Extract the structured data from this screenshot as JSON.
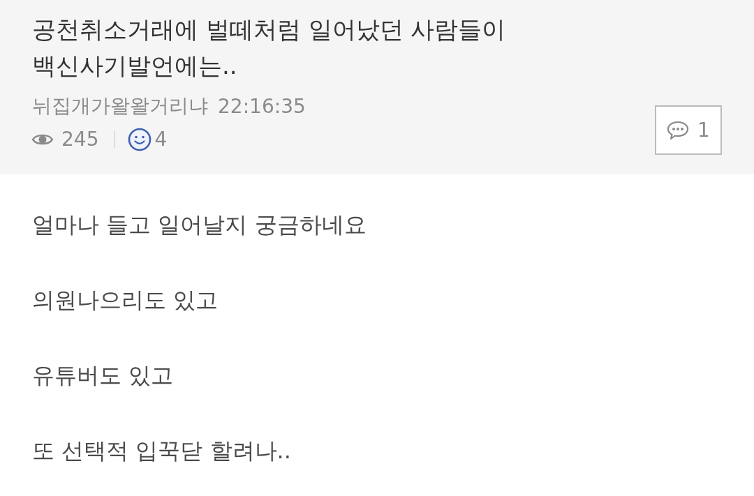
{
  "post": {
    "title": "공천취소거래에 벌떼처럼 일어났던 사람들이 백신사기발언에는..",
    "author": "뉘집개가왈왈거리냐",
    "time": "22:16:35",
    "views": "245",
    "reactions": "4",
    "comments": "1"
  },
  "body": {
    "paragraphs": [
      "얼마나 들고 일어날지 궁금하네요",
      "의원나으리도 있고",
      "유튜버도 있고",
      "또 선택적 입꾹닫 할려나.."
    ]
  }
}
